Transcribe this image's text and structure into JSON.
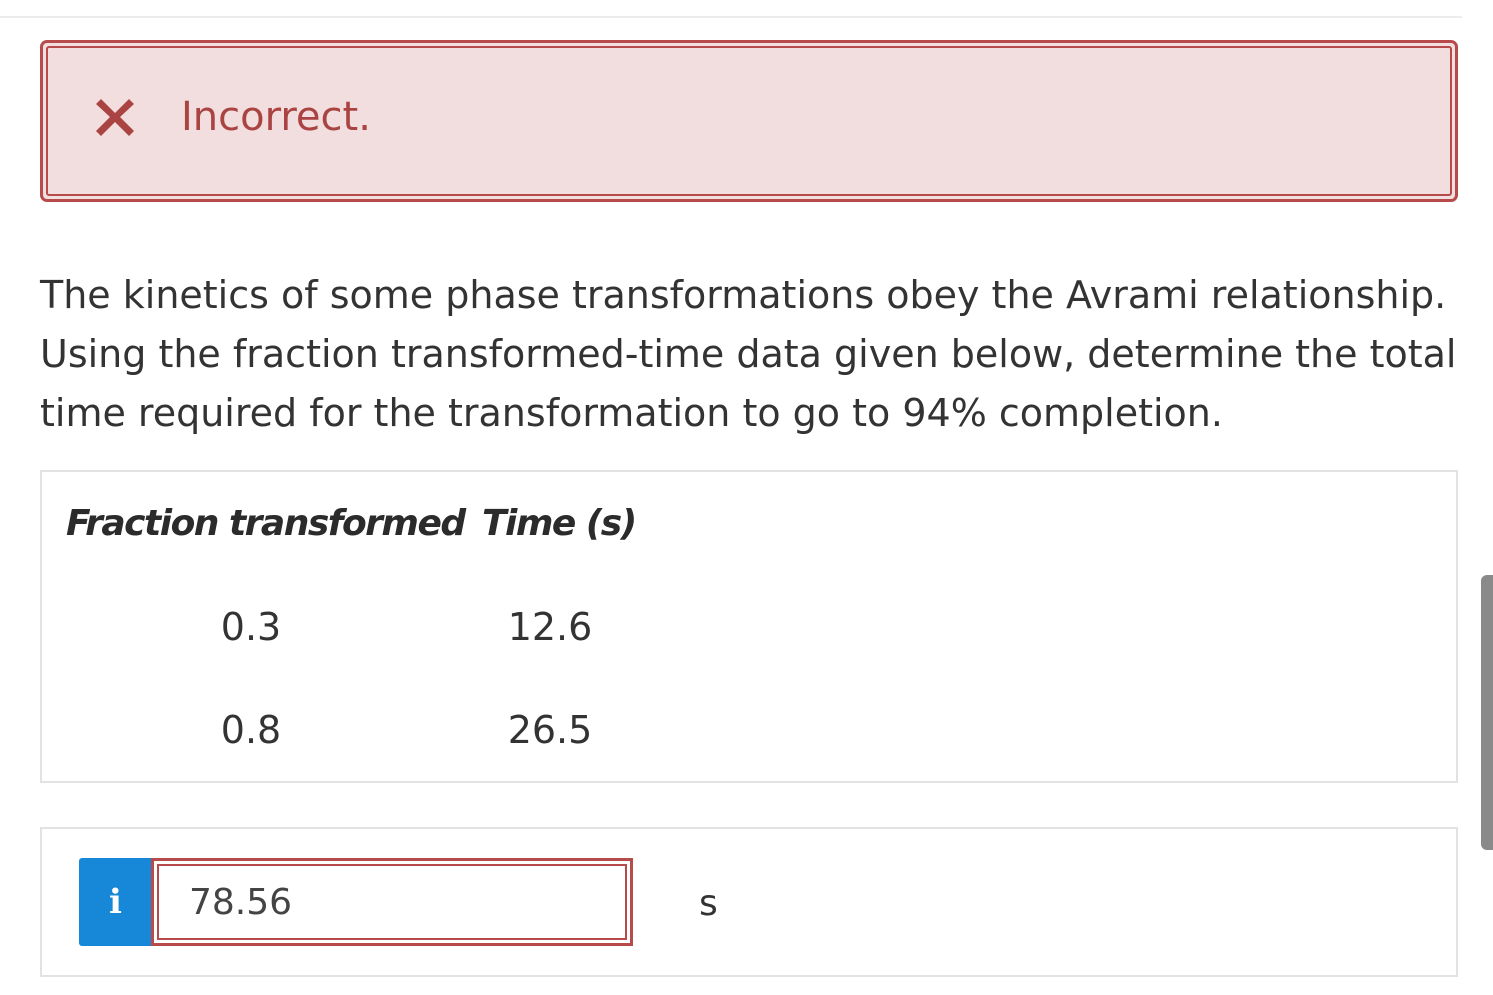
{
  "feedback": {
    "status_text": "Incorrect.",
    "icon": "close-icon",
    "color": "#a94442",
    "background": "#f2dede"
  },
  "question": {
    "text": "The kinetics of some phase transformations obey the Avrami relationship. Using the fraction transformed-time data given below, determine the total time required for the transformation to go to 94% completion."
  },
  "data_table": {
    "headers": [
      "Fraction transformed",
      "Time (s)"
    ],
    "rows": [
      [
        "0.3",
        "12.6"
      ],
      [
        "0.8",
        "26.5"
      ]
    ]
  },
  "answer": {
    "info_icon_label": "i",
    "value": "78.56",
    "unit": "s",
    "info_color": "#1788d8",
    "error_border_color": "#b74a4a"
  }
}
